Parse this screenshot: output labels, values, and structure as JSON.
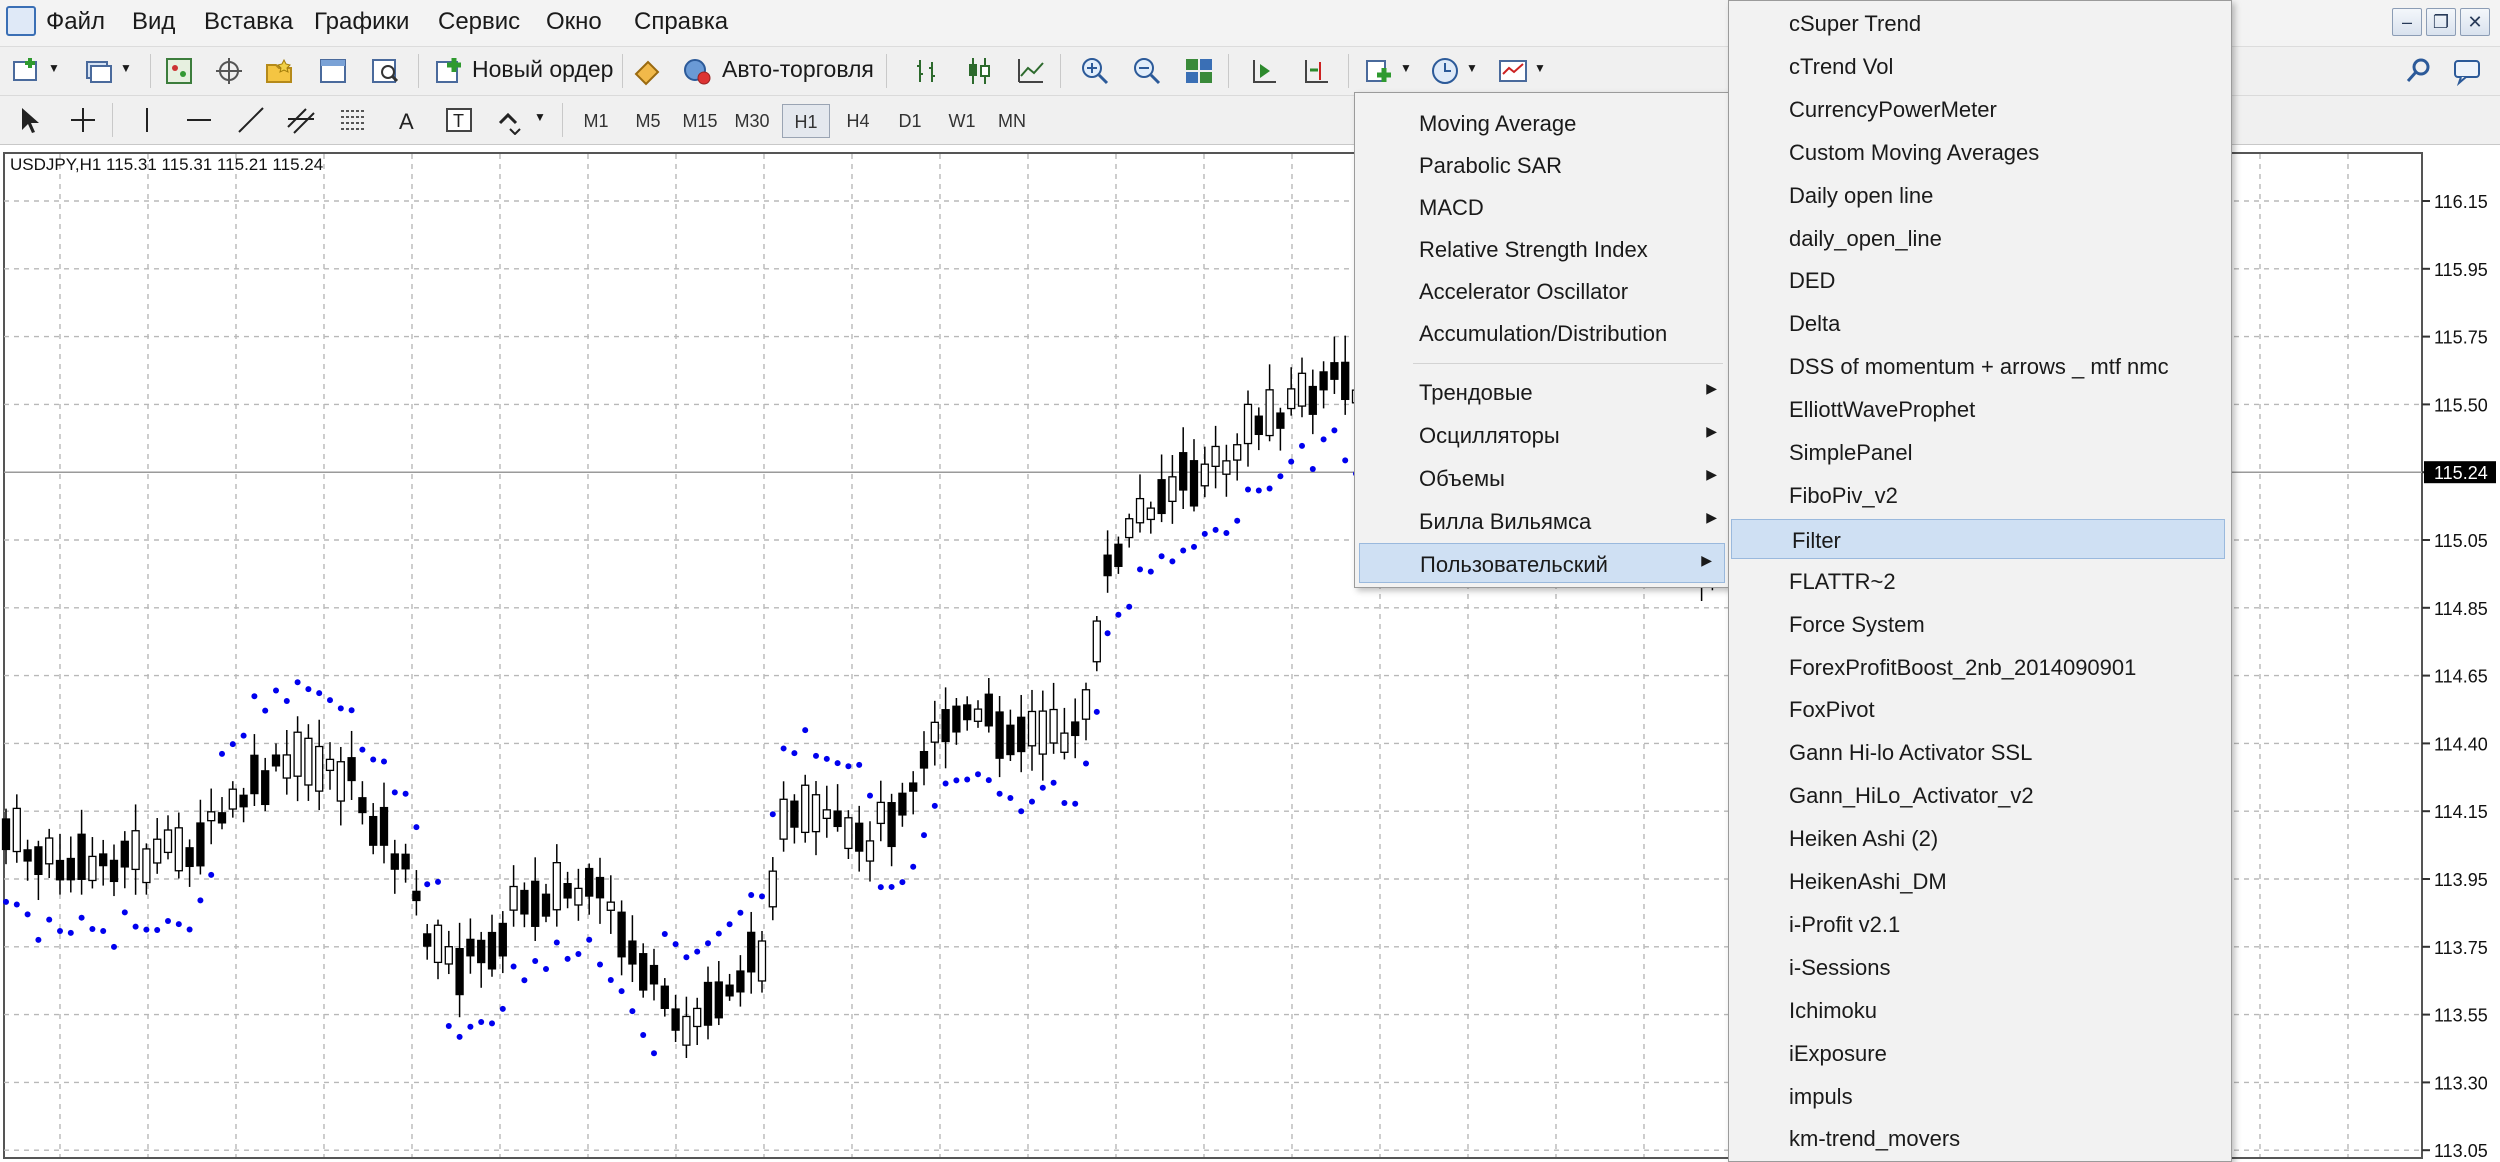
{
  "menubar": {
    "items": [
      "Файл",
      "Вид",
      "Вставка",
      "Графики",
      "Сервис",
      "Окно",
      "Справка"
    ]
  },
  "toolbar": {
    "new_order_label": "Новый ордер",
    "auto_trading_label": "Авто-торговля",
    "timeframes": [
      "M1",
      "M5",
      "M15",
      "M30",
      "H1",
      "H4",
      "D1",
      "W1",
      "MN"
    ],
    "active_timeframe": "H1"
  },
  "chart": {
    "header": "USDJPY,H1  115.31 115.31 115.21 115.24",
    "price_labels": [
      "116.15",
      "115.95",
      "115.75",
      "115.50",
      "115.24",
      "115.05",
      "114.85",
      "114.65",
      "114.40",
      "114.15",
      "113.95",
      "113.75",
      "113.55",
      "113.30",
      "113.05"
    ],
    "current_price": "115.24",
    "colors": {
      "candle": "#000000",
      "sar_dots": "#0000ee",
      "grid": "#b8b8b8",
      "price_tag_bg": "#000000"
    }
  },
  "indicators_menu": {
    "items": [
      "Moving Average",
      "Parabolic SAR",
      "MACD",
      "Relative Strength Index",
      "Accelerator Oscillator",
      "Accumulation/Distribution"
    ],
    "groups": [
      "Трендовые",
      "Осцилляторы",
      "Объемы",
      "Билла Вильямса",
      "Пользовательский"
    ],
    "highlighted": "Пользовательский"
  },
  "custom_submenu": {
    "items": [
      "cSuper Trend",
      "cTrend Vol",
      "CurrencyPowerMeter",
      "Custom Moving Averages",
      "Daily open line",
      "daily_open_line",
      "DED",
      "Delta",
      "DSS of momentum + arrows _ mtf nmc",
      "ElliottWaveProphet",
      "SimplePanel",
      "FiboPiv_v2",
      "Filter",
      "FLATTR~2",
      "Force System",
      "ForexProfitBoost_2nb_2014090901",
      "FoxPivot",
      "Gann Hi-lo Activator SSL",
      "Gann_HiLo_Activator_v2",
      "Heiken Ashi (2)",
      "HeikenAshi_DM",
      "i-Profit v2.1",
      "i-Sessions",
      "Ichimoku",
      "iExposure",
      "impuls",
      "km-trend_movers"
    ],
    "highlighted": "Filter"
  }
}
